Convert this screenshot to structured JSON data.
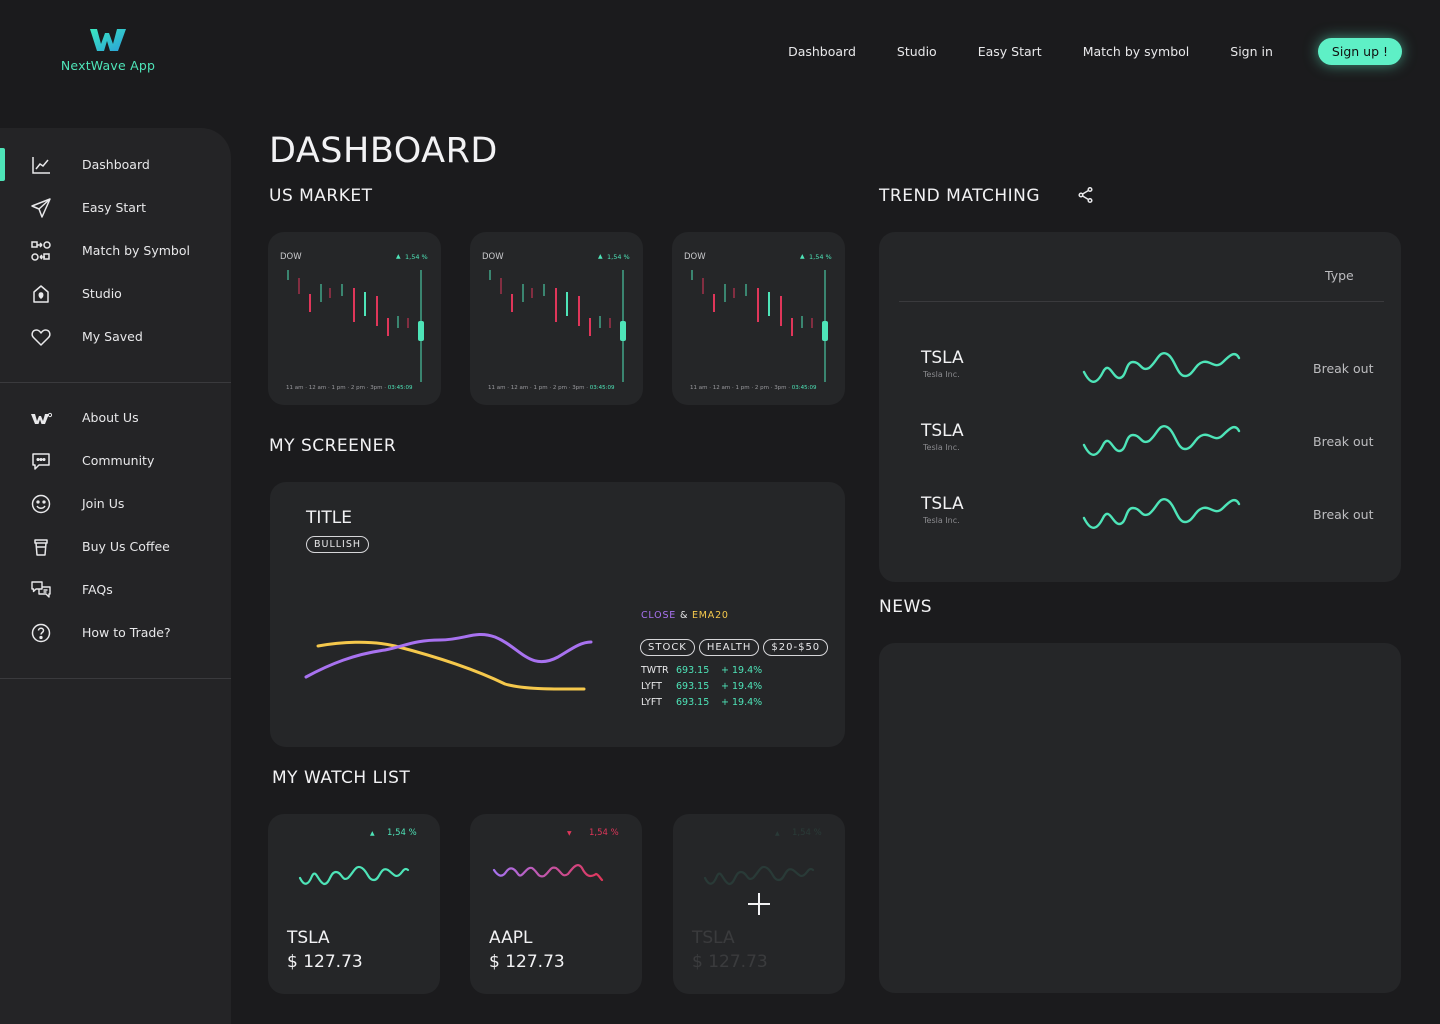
{
  "app": {
    "name": "NextWave App",
    "accent": "#4ee4b8",
    "bullish_color": "#4ee4b8",
    "bearish_color": "#e0365a"
  },
  "topnav": {
    "items": [
      "Dashboard",
      "Studio",
      "Easy Start",
      "Match by symbol",
      "Sign in"
    ],
    "signup_label": "Sign up !"
  },
  "sidebar": {
    "primary": [
      {
        "label": "Dashboard",
        "icon": "chart-line-icon",
        "active": true
      },
      {
        "label": "Easy Start",
        "icon": "paper-plane-icon"
      },
      {
        "label": "Match by Symbol",
        "icon": "match-nodes-icon"
      },
      {
        "label": "Studio",
        "icon": "studio-house-icon"
      },
      {
        "label": "My Saved",
        "icon": "heart-icon"
      }
    ],
    "secondary": [
      {
        "label": "About Us",
        "icon": "logo-small-icon"
      },
      {
        "label": "Community",
        "icon": "chat-bubble-icon"
      },
      {
        "label": "Join Us",
        "icon": "smiley-icon"
      },
      {
        "label": "Buy Us Coffee",
        "icon": "coffee-cup-icon"
      },
      {
        "label": "FAQs",
        "icon": "faq-bubbles-icon"
      },
      {
        "label": "How to Trade?",
        "icon": "question-circle-icon"
      }
    ]
  },
  "page": {
    "title": "DASHBOARD",
    "us_market_title": "US MARKET",
    "screener_title": "MY SCREENER",
    "watchlist_title": "MY WATCH LIST",
    "trend_title": "TREND MATCHING",
    "news_title": "NEWS"
  },
  "market_cards": [
    {
      "index": "DOW",
      "change": "1,54 %",
      "direction": "up",
      "time_axis": [
        "11 am",
        "12 am",
        "1 pm",
        "2 pm",
        "3pm"
      ],
      "current_time": "03:45:09"
    },
    {
      "index": "DOW",
      "change": "1,54 %",
      "direction": "up",
      "time_axis": [
        "11 am",
        "12 am",
        "1 pm",
        "2 pm",
        "3pm"
      ],
      "current_time": "03:45:09"
    },
    {
      "index": "DOW",
      "change": "1,54 %",
      "direction": "up",
      "time_axis": [
        "11 am",
        "12 am",
        "1 pm",
        "2 pm",
        "3pm"
      ],
      "current_time": "03:45:09"
    }
  ],
  "screener": {
    "title": "TITLE",
    "badge": "BULLISH",
    "legend_close": "CLOSE",
    "legend_amp": "&",
    "legend_ema": "EMA20",
    "close_color": "#a872f0",
    "ema_color": "#f5c84c",
    "chips": [
      "STOCK",
      "HEALTH",
      "$20-$50"
    ],
    "rows": [
      {
        "ticker": "TWTR",
        "price": "693.15",
        "change": "+ 19.4%"
      },
      {
        "ticker": "LYFT",
        "price": "693.15",
        "change": "+ 19.4%"
      },
      {
        "ticker": "LYFT",
        "price": "693.15",
        "change": "+ 19.4%"
      }
    ]
  },
  "watchlist": [
    {
      "symbol": "TSLA",
      "price": "$ 127.73",
      "change": "1,54 %",
      "direction": "up"
    },
    {
      "symbol": "AAPL",
      "price": "$ 127.73",
      "change": "1,54 %",
      "direction": "down"
    },
    {
      "symbol": "TSLA",
      "price": "$ 127.73",
      "change": "1,54 %",
      "direction": "up",
      "placeholder": true
    }
  ],
  "trend_matching": {
    "column_type": "Type",
    "rows": [
      {
        "symbol": "TSLA",
        "name": "Tesla Inc.",
        "type": "Break out"
      },
      {
        "symbol": "TSLA",
        "name": "Tesla Inc.",
        "type": "Break out"
      },
      {
        "symbol": "TSLA",
        "name": "Tesla Inc.",
        "type": "Break out"
      }
    ]
  }
}
